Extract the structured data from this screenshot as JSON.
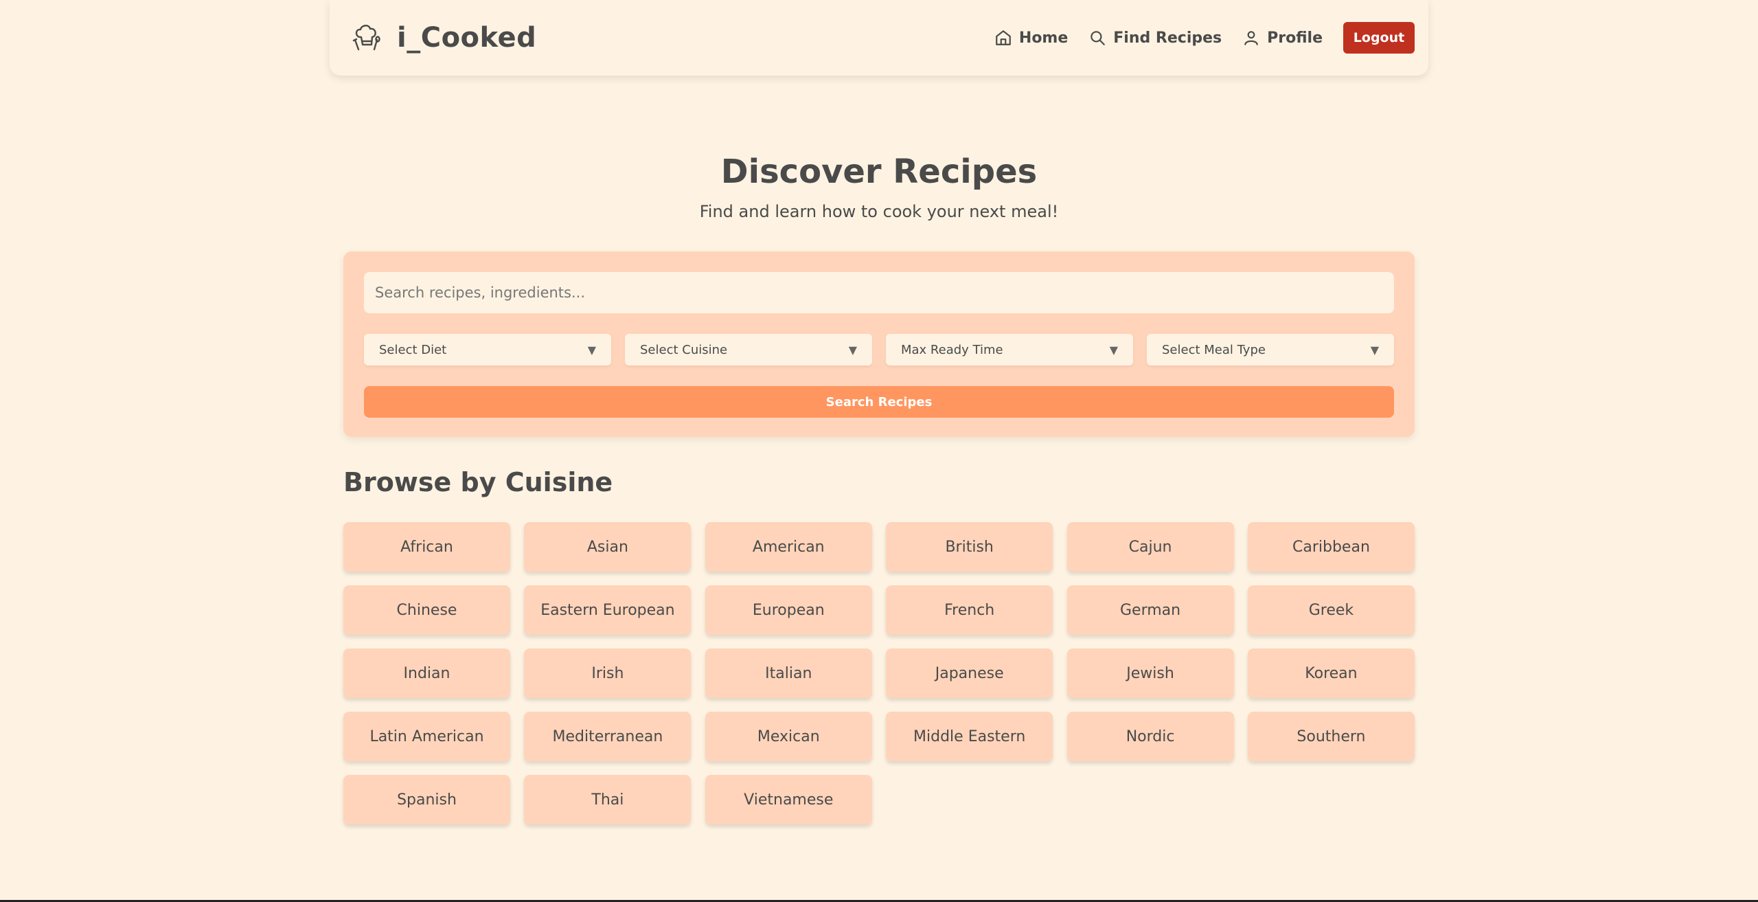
{
  "brand": {
    "name": "i_Cooked",
    "logo_icon": "chef-hat-icon"
  },
  "nav": {
    "home": "Home",
    "find_recipes": "Find Recipes",
    "profile": "Profile",
    "logout": "Logout"
  },
  "hero": {
    "title": "Discover Recipes",
    "subtitle": "Find and learn how to cook your next meal!"
  },
  "search": {
    "placeholder": "Search recipes, ingredients...",
    "filters": [
      "Select Diet",
      "Select Cuisine",
      "Max Ready Time",
      "Select Meal Type"
    ],
    "button": "Search Recipes"
  },
  "browse": {
    "title": "Browse by Cuisine",
    "cuisines": [
      "African",
      "Asian",
      "American",
      "British",
      "Cajun",
      "Caribbean",
      "Chinese",
      "Eastern European",
      "European",
      "French",
      "German",
      "Greek",
      "Indian",
      "Irish",
      "Italian",
      "Japanese",
      "Jewish",
      "Korean",
      "Latin American",
      "Mediterranean",
      "Mexican",
      "Middle Eastern",
      "Nordic",
      "Southern",
      "Spanish",
      "Thai",
      "Vietnamese"
    ]
  },
  "colors": {
    "background": "#fef3e2",
    "panel": "#ffd4ba",
    "accent": "#ff9660",
    "logout": "#c0301f",
    "text": "#4a4a4a"
  }
}
